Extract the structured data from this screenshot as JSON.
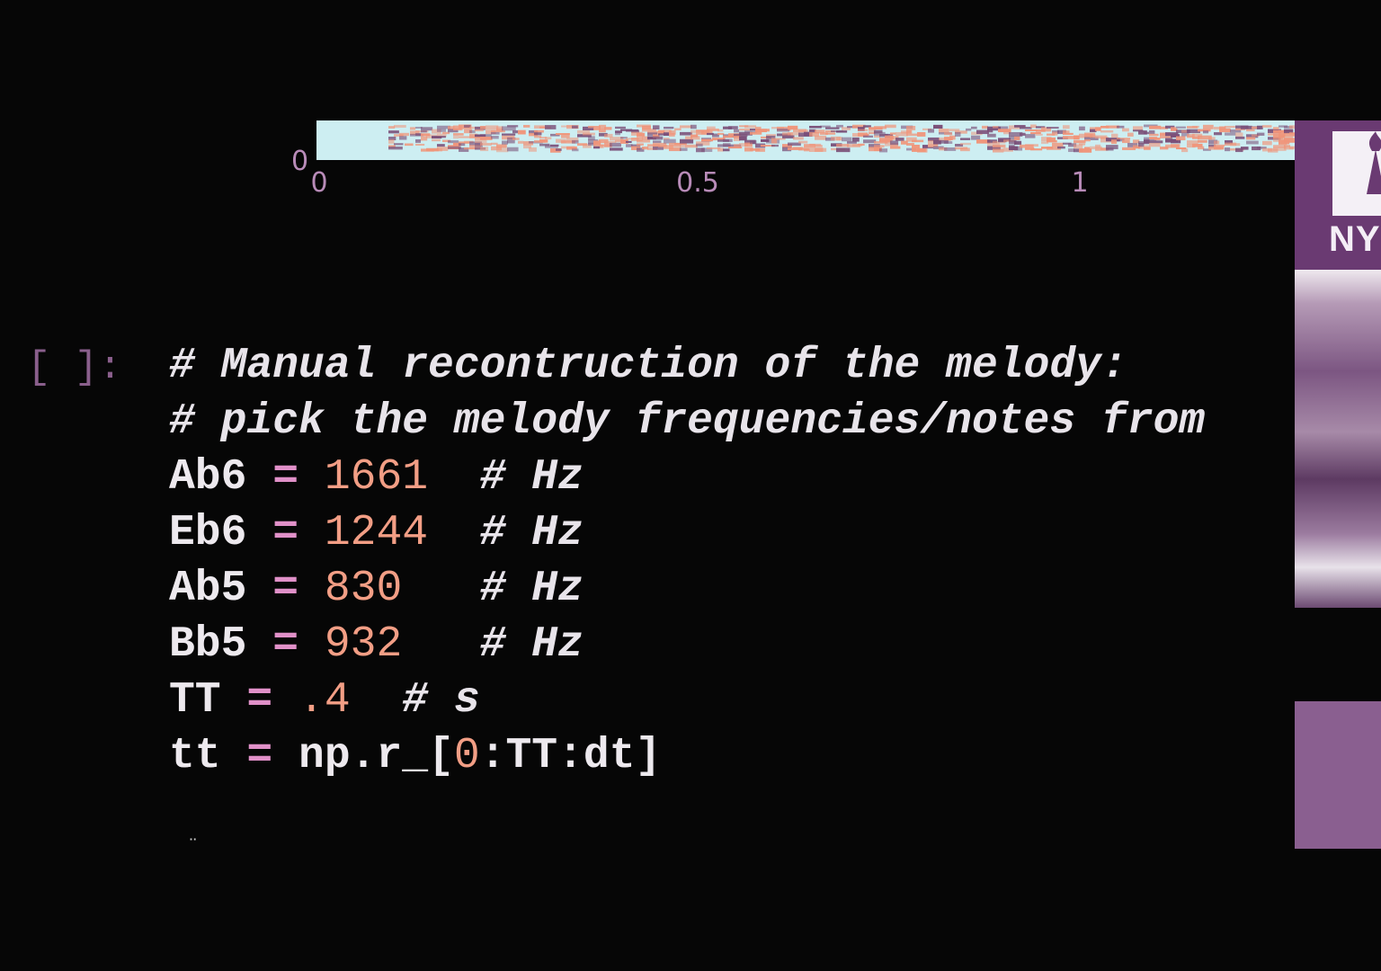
{
  "plot": {
    "x_ticks": [
      "0",
      "0.5",
      "1"
    ],
    "y_tick": "0"
  },
  "cell": {
    "prompt": "[ ]:",
    "lines": [
      {
        "parts": [
          {
            "t": "# Manual recontruction of the melody:",
            "k": "cmt"
          }
        ]
      },
      {
        "parts": [
          {
            "t": "# pick the melody frequencies/notes from",
            "k": "cmt"
          }
        ]
      },
      {
        "parts": [
          {
            "t": "Ab6 ",
            "k": ""
          },
          {
            "t": "=",
            "k": "op"
          },
          {
            "t": " ",
            "k": ""
          },
          {
            "t": "1661",
            "k": "num"
          },
          {
            "t": "  ",
            "k": ""
          },
          {
            "t": "# Hz",
            "k": "cmt"
          }
        ]
      },
      {
        "parts": [
          {
            "t": "Eb6 ",
            "k": ""
          },
          {
            "t": "=",
            "k": "op"
          },
          {
            "t": " ",
            "k": ""
          },
          {
            "t": "1244",
            "k": "num"
          },
          {
            "t": "  ",
            "k": ""
          },
          {
            "t": "# Hz",
            "k": "cmt"
          }
        ]
      },
      {
        "parts": [
          {
            "t": "Ab5 ",
            "k": ""
          },
          {
            "t": "=",
            "k": "op"
          },
          {
            "t": " ",
            "k": ""
          },
          {
            "t": "830",
            "k": "num"
          },
          {
            "t": "   ",
            "k": ""
          },
          {
            "t": "# Hz",
            "k": "cmt"
          }
        ]
      },
      {
        "parts": [
          {
            "t": "Bb5 ",
            "k": ""
          },
          {
            "t": "=",
            "k": "op"
          },
          {
            "t": " ",
            "k": ""
          },
          {
            "t": "932",
            "k": "num"
          },
          {
            "t": "   ",
            "k": ""
          },
          {
            "t": "# Hz",
            "k": "cmt"
          }
        ]
      },
      {
        "parts": [
          {
            "t": "TT ",
            "k": ""
          },
          {
            "t": "=",
            "k": "op"
          },
          {
            "t": " ",
            "k": ""
          },
          {
            "t": ".4",
            "k": "num"
          },
          {
            "t": "  ",
            "k": ""
          },
          {
            "t": "# s",
            "k": "cmt"
          }
        ]
      },
      {
        "parts": [
          {
            "t": "tt ",
            "k": ""
          },
          {
            "t": "=",
            "k": "op"
          },
          {
            "t": " np.r_[",
            "k": ""
          },
          {
            "t": "0",
            "k": "num"
          },
          {
            "t": ":TT:dt]",
            "k": ""
          }
        ]
      }
    ]
  },
  "side_panel": {
    "brand": "NY",
    "logo_icon": "torch-icon"
  },
  "colors": {
    "background": "#060606",
    "number": "#f29e85",
    "prompt": "#8a5f8c",
    "spectrogram_base": "#cdeef2",
    "spectrogram_band": "#f0957a",
    "spectrogram_dark": "#7a4f78"
  }
}
